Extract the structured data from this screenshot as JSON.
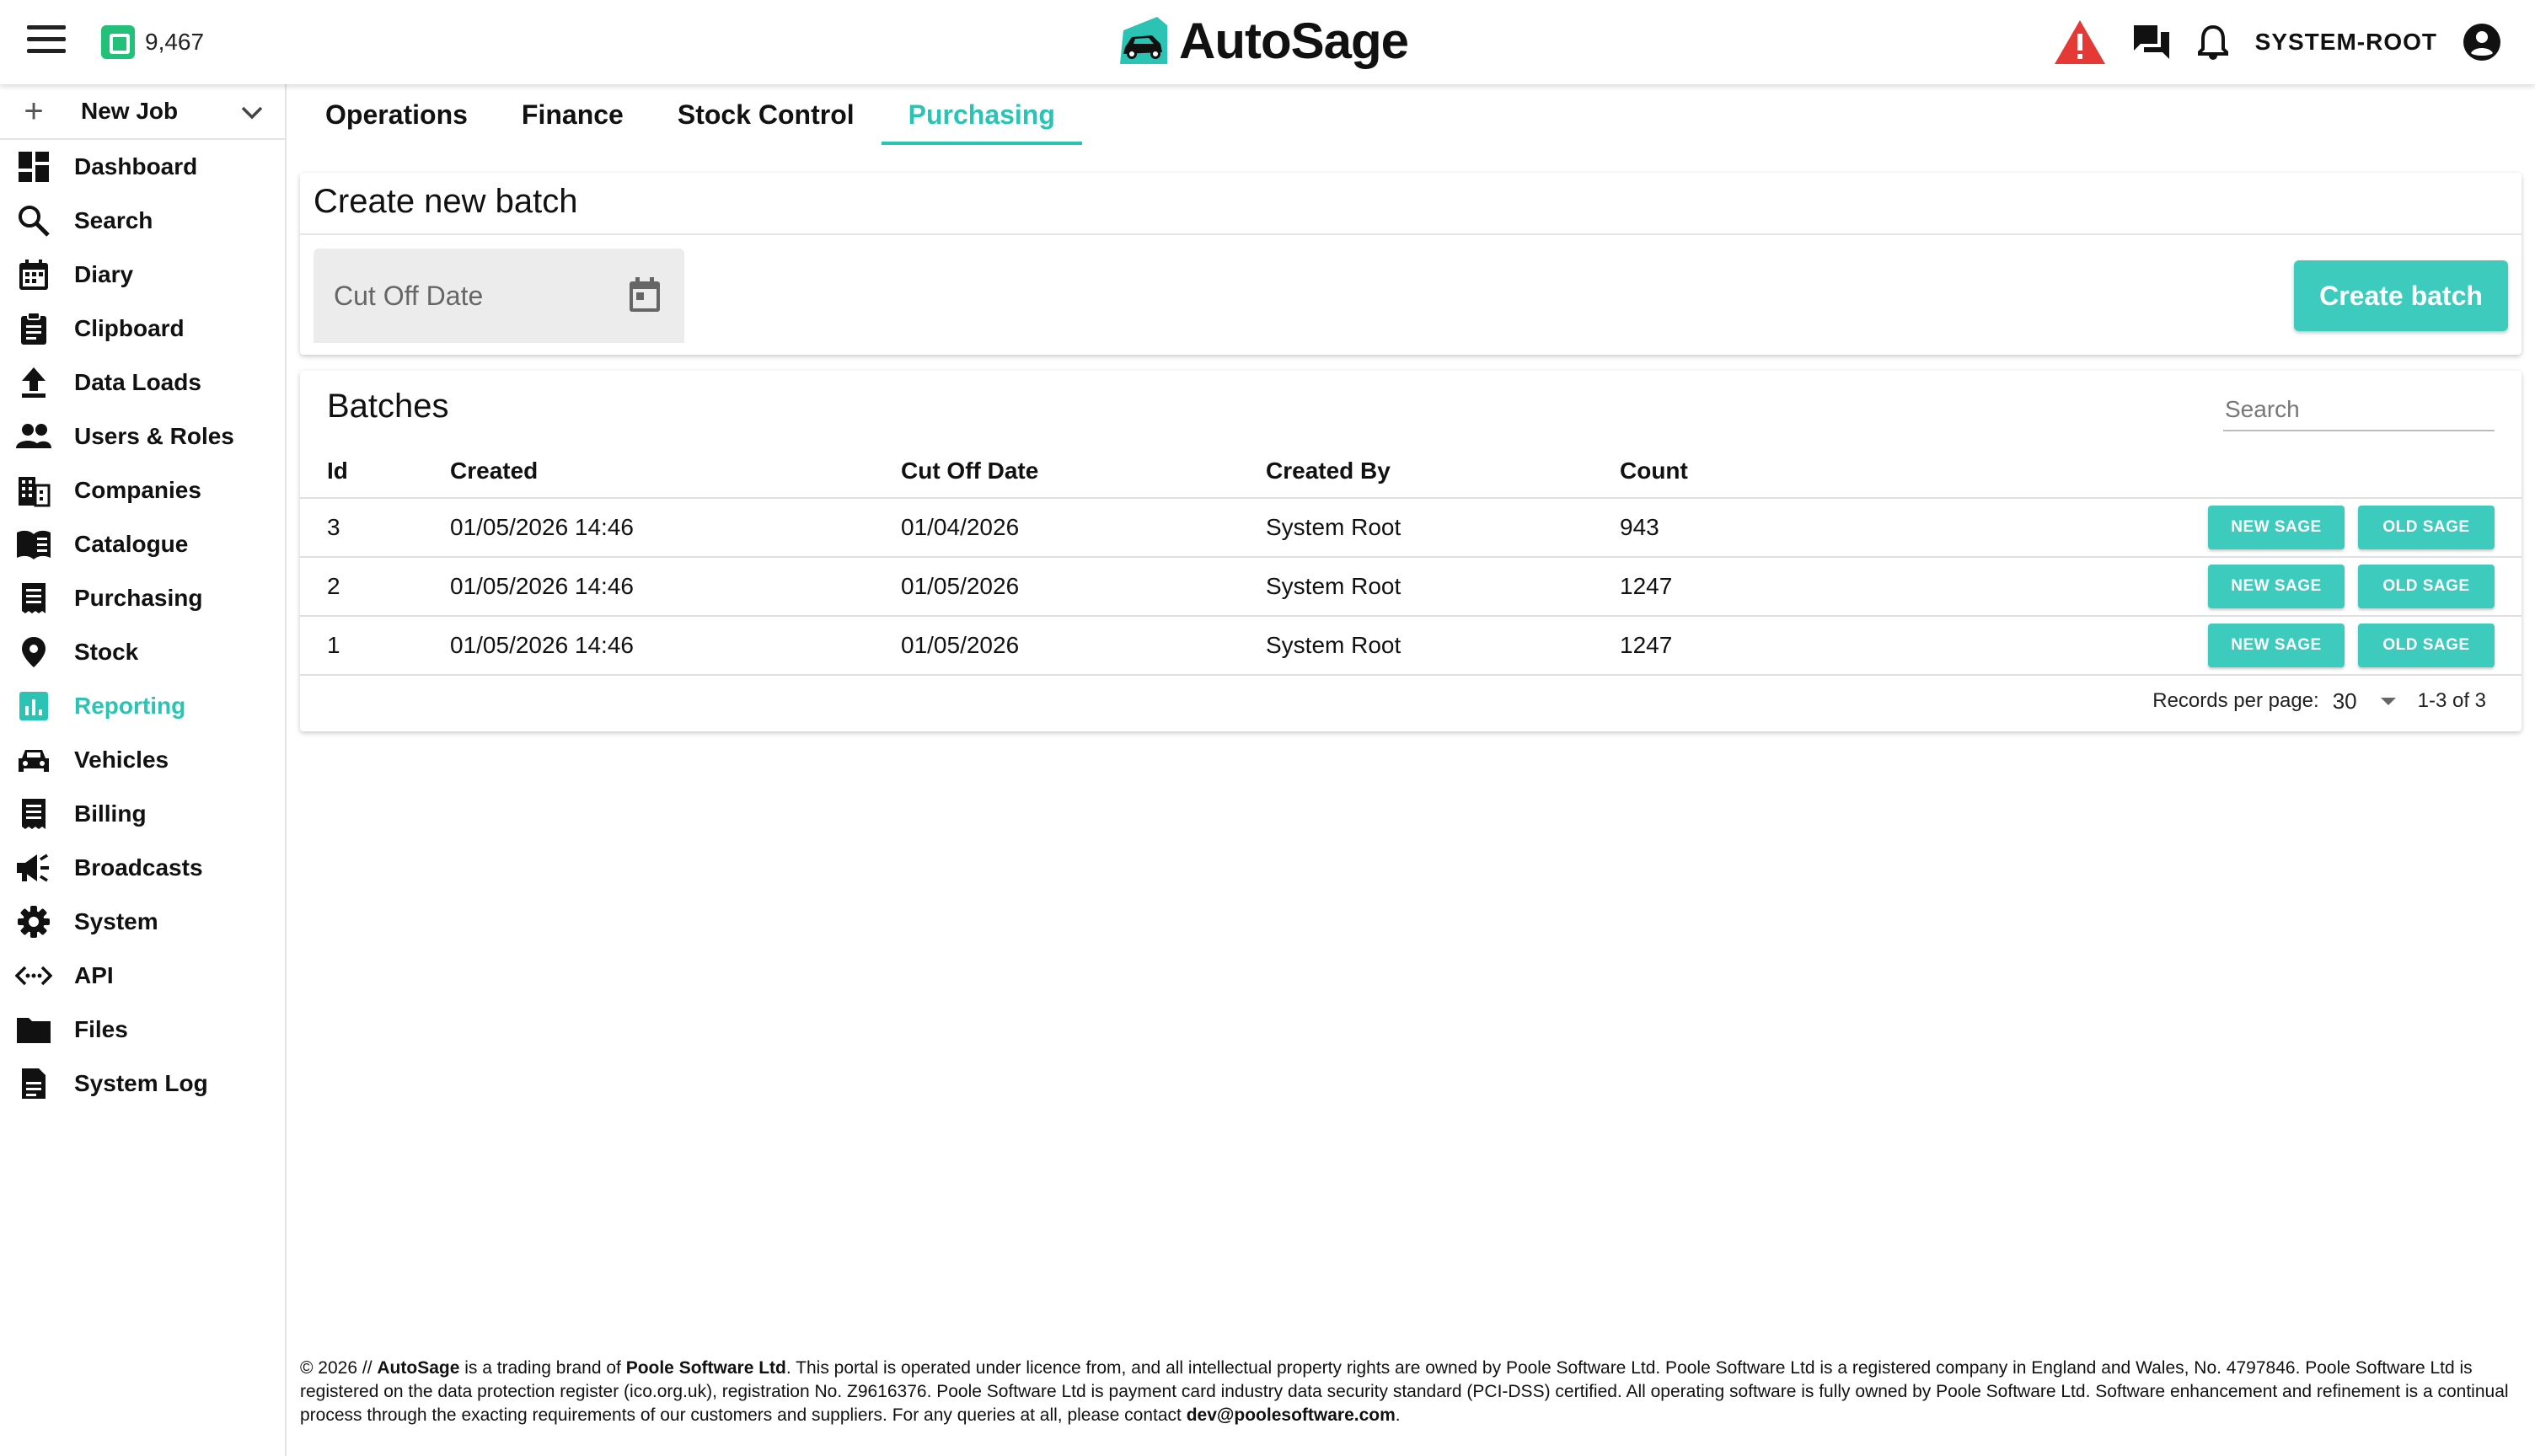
{
  "header": {
    "credit_balance": "9,467",
    "brand_name": "AutoSage",
    "user_name": "SYSTEM-ROOT",
    "colors": {
      "accent": "#2bc4b4",
      "warning": "#e53935",
      "credit": "#21c17a"
    }
  },
  "sidebar": {
    "new_job_label": "New Job",
    "items": [
      {
        "label": "Dashboard",
        "icon": "dashboard-icon"
      },
      {
        "label": "Search",
        "icon": "search-icon"
      },
      {
        "label": "Diary",
        "icon": "calendar-icon"
      },
      {
        "label": "Clipboard",
        "icon": "clipboard-icon"
      },
      {
        "label": "Data Loads",
        "icon": "upload-icon"
      },
      {
        "label": "Users & Roles",
        "icon": "users-icon"
      },
      {
        "label": "Companies",
        "icon": "building-icon"
      },
      {
        "label": "Catalogue",
        "icon": "book-icon"
      },
      {
        "label": "Purchasing",
        "icon": "receipt-icon"
      },
      {
        "label": "Stock",
        "icon": "location-pin-icon"
      },
      {
        "label": "Reporting",
        "icon": "chart-icon",
        "active": true
      },
      {
        "label": "Vehicles",
        "icon": "car-icon"
      },
      {
        "label": "Billing",
        "icon": "receipt-icon"
      },
      {
        "label": "Broadcasts",
        "icon": "megaphone-icon"
      },
      {
        "label": "System",
        "icon": "gear-icon"
      },
      {
        "label": "API",
        "icon": "code-icon"
      },
      {
        "label": "Files",
        "icon": "folder-icon"
      },
      {
        "label": "System Log",
        "icon": "document-icon"
      }
    ]
  },
  "tabs": [
    {
      "label": "Operations"
    },
    {
      "label": "Finance"
    },
    {
      "label": "Stock Control"
    },
    {
      "label": "Purchasing",
      "active": true
    }
  ],
  "create_batch": {
    "title": "Create new batch",
    "cutoff_placeholder": "Cut Off Date",
    "button_label": "Create batch"
  },
  "batches": {
    "title": "Batches",
    "search_placeholder": "Search",
    "columns": [
      "Id",
      "Created",
      "Cut Off Date",
      "Created By",
      "Count"
    ],
    "rows": [
      {
        "id": "3",
        "created": "01/05/2026 14:46",
        "cutoff": "01/04/2026",
        "created_by": "System Root",
        "count": "943"
      },
      {
        "id": "2",
        "created": "01/05/2026 14:46",
        "cutoff": "01/05/2026",
        "created_by": "System Root",
        "count": "1247"
      },
      {
        "id": "1",
        "created": "01/05/2026 14:46",
        "cutoff": "01/05/2026",
        "created_by": "System Root",
        "count": "1247"
      }
    ],
    "new_sage_label": "NEW SAGE",
    "old_sage_label": "OLD SAGE",
    "records_per_page_label": "Records per page:",
    "records_per_page": "30",
    "range": "1-3 of 3"
  },
  "footer": {
    "p1": "© 2026 // ",
    "brand": "AutoSage",
    "p2": " is a trading brand of ",
    "company": "Poole Software Ltd",
    "p3": ". This portal is operated under licence from, and all intellectual property rights are owned by Poole Software Ltd. Poole Software Ltd is a registered company in England and Wales, No. 4797846. Poole Software Ltd is registered on the data protection register (ico.org.uk), registration No. Z9616376. Poole Software Ltd is payment card industry data security standard (PCI-DSS) certified. All operating software is fully owned by Poole Software Ltd. Software enhancement and refinement is a continual process through the exacting requirements of our customers and suppliers. For any queries at all, please contact ",
    "email": "dev@poolesoftware.com",
    "p4": "."
  }
}
